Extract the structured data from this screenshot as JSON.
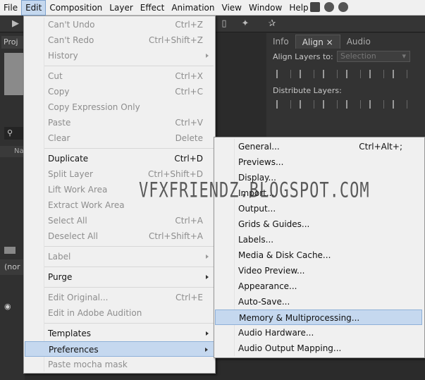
{
  "menubar": {
    "items": [
      "File",
      "Edit",
      "Composition",
      "Layer",
      "Effect",
      "Animation",
      "View",
      "Window",
      "Help"
    ]
  },
  "project_panel": {
    "tab_label": "Proj",
    "search_icon": "search-icon",
    "column_label": "Na"
  },
  "timeline": {
    "tab_label": "(nor"
  },
  "align_panel": {
    "tabs": [
      "Info",
      "Align",
      "Audio"
    ],
    "align_layers_label": "Align Layers to:",
    "align_select_value": "Selection",
    "distribute_label": "Distribute Layers:"
  },
  "edit_menu": {
    "items": [
      {
        "label": "Can't Undo",
        "shortcut": "Ctrl+Z",
        "disabled": true
      },
      {
        "label": "Can't Redo",
        "shortcut": "Ctrl+Shift+Z",
        "disabled": true
      },
      {
        "label": "History",
        "shortcut": "",
        "disabled": true,
        "submenu": true
      },
      {
        "label": "Cut",
        "shortcut": "Ctrl+X",
        "disabled": true
      },
      {
        "label": "Copy",
        "shortcut": "Ctrl+C",
        "disabled": true
      },
      {
        "label": "Copy Expression Only",
        "shortcut": "",
        "disabled": true
      },
      {
        "label": "Paste",
        "shortcut": "Ctrl+V",
        "disabled": true
      },
      {
        "label": "Clear",
        "shortcut": "Delete",
        "disabled": true
      },
      {
        "label": "Duplicate",
        "shortcut": "Ctrl+D",
        "disabled": false
      },
      {
        "label": "Split Layer",
        "shortcut": "Ctrl+Shift+D",
        "disabled": true
      },
      {
        "label": "Lift Work Area",
        "shortcut": "",
        "disabled": true
      },
      {
        "label": "Extract Work Area",
        "shortcut": "",
        "disabled": true
      },
      {
        "label": "Select All",
        "shortcut": "Ctrl+A",
        "disabled": true
      },
      {
        "label": "Deselect All",
        "shortcut": "Ctrl+Shift+A",
        "disabled": true
      },
      {
        "label": "Label",
        "shortcut": "",
        "disabled": true,
        "submenu": true
      },
      {
        "label": "Purge",
        "shortcut": "",
        "disabled": false,
        "submenu": true
      },
      {
        "label": "Edit Original...",
        "shortcut": "Ctrl+E",
        "disabled": true
      },
      {
        "label": "Edit in Adobe Audition",
        "shortcut": "",
        "disabled": true
      },
      {
        "label": "Templates",
        "shortcut": "",
        "disabled": false,
        "submenu": true
      },
      {
        "label": "Preferences",
        "shortcut": "",
        "disabled": false,
        "submenu": true,
        "highlighted": true
      },
      {
        "label": "Paste mocha mask",
        "shortcut": "",
        "disabled": true
      }
    ]
  },
  "preferences_menu": {
    "items": [
      {
        "label": "General...",
        "shortcut": "Ctrl+Alt+;"
      },
      {
        "label": "Previews...",
        "shortcut": ""
      },
      {
        "label": "Display...",
        "shortcut": ""
      },
      {
        "label": "Import...",
        "shortcut": ""
      },
      {
        "label": "Output...",
        "shortcut": ""
      },
      {
        "label": "Grids & Guides...",
        "shortcut": ""
      },
      {
        "label": "Labels...",
        "shortcut": ""
      },
      {
        "label": "Media & Disk Cache...",
        "shortcut": ""
      },
      {
        "label": "Video Preview...",
        "shortcut": ""
      },
      {
        "label": "Appearance...",
        "shortcut": ""
      },
      {
        "label": "Auto-Save...",
        "shortcut": ""
      },
      {
        "label": "Memory & Multiprocessing...",
        "shortcut": "",
        "highlighted": true
      },
      {
        "label": "Audio Hardware...",
        "shortcut": ""
      },
      {
        "label": "Audio Output Mapping...",
        "shortcut": ""
      }
    ]
  },
  "watermark": "VFXFRIENDZ.BLOGSPOT.COM",
  "colors": {
    "menu_bg": "#f0f0f0",
    "highlight_bg": "#c5d8ef",
    "highlight_border": "#8eb0d8",
    "disabled_text": "#8d8d8d",
    "app_bg": "#2b2b2b"
  }
}
